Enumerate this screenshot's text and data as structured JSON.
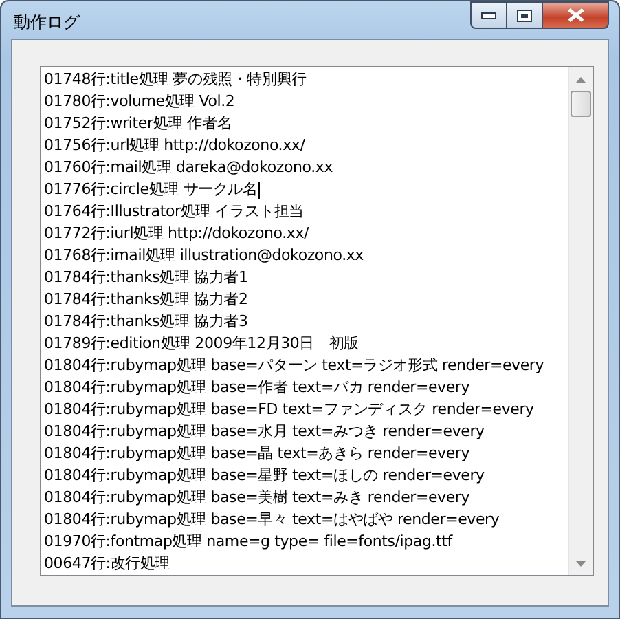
{
  "window": {
    "title": "動作ログ"
  },
  "log": {
    "lines": [
      {
        "text": "01748行:title処理 夢の残照・特別興行",
        "caret": false
      },
      {
        "text": "01780行:volume処理 Vol.2",
        "caret": false
      },
      {
        "text": "01752行:writer処理 作者名",
        "caret": false
      },
      {
        "text": "01756行:url処理 http://dokozono.xx/",
        "caret": false
      },
      {
        "text": "01760行:mail処理 dareka@dokozono.xx",
        "caret": false
      },
      {
        "text": "01776行:circle処理 サークル名",
        "caret": true
      },
      {
        "text": "01764行:Illustrator処理 イラスト担当",
        "caret": false
      },
      {
        "text": "01772行:iurl処理 http://dokozono.xx/",
        "caret": false
      },
      {
        "text": "01768行:imail処理 illustration@dokozono.xx",
        "caret": false
      },
      {
        "text": "01784行:thanks処理 協力者1",
        "caret": false
      },
      {
        "text": "01784行:thanks処理 協力者2",
        "caret": false
      },
      {
        "text": "01784行:thanks処理 協力者3",
        "caret": false
      },
      {
        "text": "01789行:edition処理 2009年12月30日　初版",
        "caret": false
      },
      {
        "text": "01804行:rubymap処理 base=パターン text=ラジオ形式 render=every",
        "caret": false
      },
      {
        "text": "01804行:rubymap処理 base=作者 text=バカ render=every",
        "caret": false
      },
      {
        "text": "01804行:rubymap処理 base=FD text=ファンディスク render=every",
        "caret": false
      },
      {
        "text": "01804行:rubymap処理 base=水月 text=みつき render=every",
        "caret": false
      },
      {
        "text": "01804行:rubymap処理 base=晶 text=あきら render=every",
        "caret": false
      },
      {
        "text": "01804行:rubymap処理 base=星野 text=ほしの render=every",
        "caret": false
      },
      {
        "text": "01804行:rubymap処理 base=美樹 text=みき render=every",
        "caret": false
      },
      {
        "text": "01804行:rubymap処理 base=早々 text=はやばや render=every",
        "caret": false
      },
      {
        "text": "01970行:fontmap処理 name=g type= file=fonts/ipag.ttf",
        "caret": false
      },
      {
        "text": "00647行:改行処理",
        "caret": false
      }
    ]
  }
}
